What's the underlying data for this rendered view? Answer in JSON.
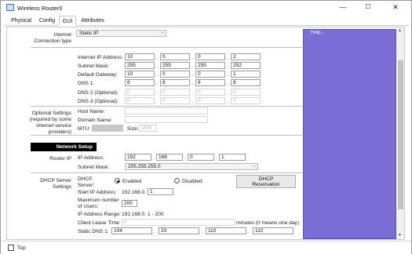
{
  "window": {
    "title": "Wireless Router0",
    "controls": {
      "minimize": "—",
      "maximize": "☐",
      "close": "✕"
    }
  },
  "tabs": [
    "Physical",
    "Config",
    "GUI",
    "Attributes"
  ],
  "internet": {
    "conn_label": "Internet\nConnection type",
    "conn_type": "Static IP",
    "ip_label": "Internet IP Address:",
    "ip": [
      "10",
      "0",
      "0",
      "2"
    ],
    "mask_label": "Subnet Mask:",
    "mask": [
      "255",
      "255",
      "255",
      "252"
    ],
    "gw_label": "Default Gateway:",
    "gw": [
      "10",
      "0",
      "0",
      "1"
    ],
    "dns1_label": "DNS 1:",
    "dns1": [
      "8",
      "8",
      "8",
      "8"
    ],
    "dns2_label": "DNS 2 (Optional):",
    "dns2": [
      "0",
      "0",
      "0",
      "0"
    ],
    "dns3_label": "DNS 3 (Optional):",
    "dns3": [
      "0",
      "0",
      "0",
      "0"
    ]
  },
  "optional": {
    "label": "Optional Settings\n(required by some\ninternet service\nproviders)",
    "host_label": "Host Name:",
    "domain_label": "Domain Name:",
    "mtu_label": "MTU:",
    "size_label": "Size:",
    "size_value": "1500"
  },
  "network_setup": {
    "label": "Network Setup",
    "router_ip_label": "Router IP",
    "ip_label": "IP Address:",
    "ip": [
      "192",
      "168",
      "0",
      "1"
    ],
    "mask_label": "Subnet Mask:",
    "mask_value": "255.255.255.0"
  },
  "dhcp": {
    "section_label": "DHCP Server\nSettings",
    "server_label": "DHCP\nServer:",
    "enabled": "Enabled",
    "disabled": "Disabled",
    "reservation_btn": "DHCP\nReservation",
    "start_label": "Start IP Address:",
    "start_prefix": "192.168.0.",
    "start_value": "1",
    "max_label": "Maximum number\nof Users:",
    "max_value": "200",
    "range_label": "IP Address Range:",
    "range_value": "192.168.0. 1 - 200",
    "lease_label": "Client Lease Time:",
    "lease_value": "0",
    "lease_unit": "minutes (0 means one day)",
    "sdns1_label": "Static DNS 1:",
    "sdns1": [
      "104",
      "33",
      "110",
      "110"
    ]
  },
  "help": {
    "label": "Help..."
  },
  "footer": {
    "top_label": "Top"
  }
}
